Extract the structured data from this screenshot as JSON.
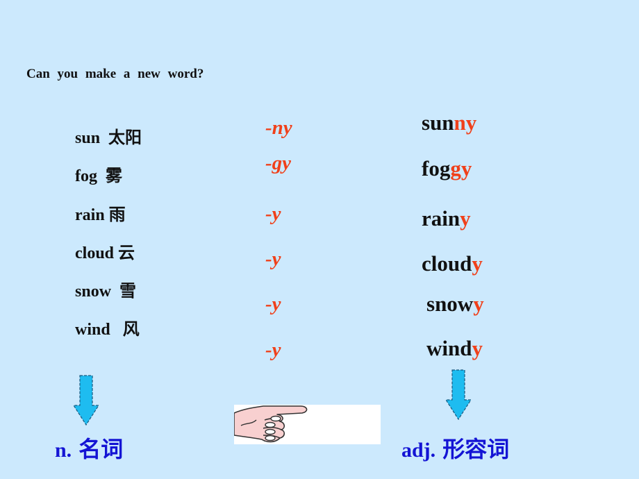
{
  "title": "Can you make a new word?",
  "nouns": [
    {
      "word": "sun",
      "gap": "  ",
      "zh": "太阳"
    },
    {
      "word": "fog",
      "gap": "  ",
      "zh": "雾"
    },
    {
      "word": "rain",
      "gap": " ",
      "zh": "雨"
    },
    {
      "word": "cloud",
      "gap": " ",
      "zh": "云"
    },
    {
      "word": "snow",
      "gap": "  ",
      "zh": "雪"
    },
    {
      "word": "wind",
      "gap": "   ",
      "zh": "风"
    }
  ],
  "suffixes": [
    "-ny",
    "-gy",
    "-y",
    "-y",
    "-y",
    "-y"
  ],
  "adjectives": [
    {
      "base": "sun",
      "suffix": "ny"
    },
    {
      "base": "fog",
      "suffix": "gy"
    },
    {
      "base": "rain",
      "suffix": "y"
    },
    {
      "base": "cloud",
      "suffix": "y"
    },
    {
      "base": "snow",
      "suffix": "y"
    },
    {
      "base": "wind",
      "suffix": "y"
    }
  ],
  "labels": {
    "noun": {
      "abbr": "n.",
      "zh": "名词"
    },
    "adj": {
      "abbr": "adj.",
      "zh": "形容词"
    }
  },
  "icons": {
    "left_arrow": "down-arrow-icon",
    "right_arrow": "down-arrow-icon",
    "hand": "pointing-hand-icon"
  },
  "colors": {
    "background": "#cce9fd",
    "suffix": "#f0401a",
    "label": "#1414d4",
    "arrow": "#1ebcf0"
  }
}
